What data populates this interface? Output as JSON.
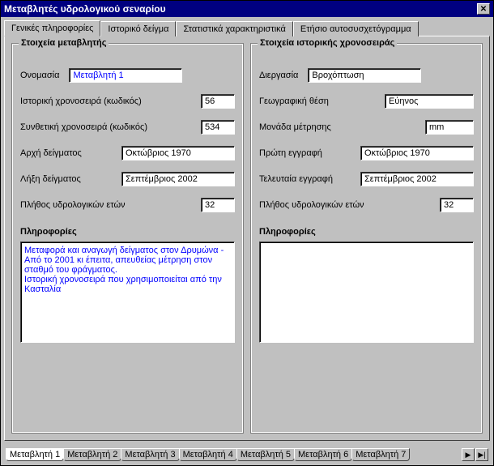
{
  "window": {
    "title": "Μεταβλητές υδρολογικού σεναρίου"
  },
  "tabs": {
    "t0": "Γενικές πληροφορίες",
    "t1": "Ιστορικό δείγμα",
    "t2": "Στατιστικά χαρακτηριστικά",
    "t3": "Ετήσιο αυτοσυσχετόγραμμα"
  },
  "left": {
    "legend": "Στοιχεία μεταβλητής",
    "name_label": "Ονομασία",
    "name_value": "Μεταβλητή 1",
    "hist_label": "Ιστορική χρονοσειρά (κωδικός)",
    "hist_value": "56",
    "synth_label": "Συνθετική χρονοσειρά (κωδικός)",
    "synth_value": "534",
    "start_label": "Αρχή δείγματος",
    "start_value": "Οκτώβριος 1970",
    "end_label": "Λήξη δείγματος",
    "end_value": "Σεπτέμβριος 2002",
    "years_label": "Πλήθος υδρολογικών ετών",
    "years_value": "32",
    "info_label": "Πληροφορίες",
    "info_text": "Μεταφορά και αναγωγή δείγματος στον Δρυμώνα - Από το 2001 κι έπειτα, απευθείας μέτρηση στον σταθμό του φράγματος.\nΙστορική χρονοσειρά που χρησιμοποιείται από την Κασταλία"
  },
  "right": {
    "legend": "Στοιχεία ιστορικής χρονοσειράς",
    "process_label": "Διεργασία",
    "process_value": "Βροχόπτωση",
    "geo_label": "Γεωγραφική θέση",
    "geo_value": "Εύηνος",
    "unit_label": "Μονάδα μέτρησης",
    "unit_value": "mm",
    "first_label": "Πρώτη εγγραφή",
    "first_value": "Οκτώβριος 1970",
    "last_label": "Τελευταία εγγραφή",
    "last_value": "Σεπτέμβριος 2002",
    "years_label": "Πλήθος υδρολογικών ετών",
    "years_value": "32",
    "info_label": "Πληροφορίες",
    "info_text": ""
  },
  "bottom_tabs": {
    "b0": "Μεταβλητή 1",
    "b1": "Μεταβλητή 2",
    "b2": "Μεταβλητή 3",
    "b3": "Μεταβλητή 4",
    "b4": "Μεταβλητή 5",
    "b5": "Μεταβλητή 6",
    "b6": "Μεταβλητή 7"
  },
  "icons": {
    "close": "✕",
    "right": "▶",
    "end": "▶|"
  }
}
